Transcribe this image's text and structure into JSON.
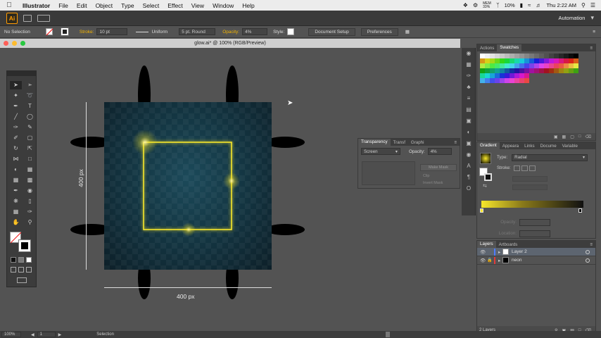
{
  "menubar": {
    "app_name": "Illustrator",
    "items": [
      "File",
      "Edit",
      "Object",
      "Type",
      "Select",
      "Effect",
      "View",
      "Window",
      "Help"
    ],
    "status": {
      "memory": "MEM\n33%",
      "battery": "10%",
      "clock": "Thu 2:22 AM"
    }
  },
  "appbar": {
    "logo": "Ai",
    "workspace": "Automation"
  },
  "control": {
    "selection": "No Selection",
    "stroke_label": "Stroke:",
    "stroke_value": "10 pt",
    "profile": "Uniform",
    "brush": "5 pt. Round",
    "opacity_label": "Opacity:",
    "opacity_value": "4%",
    "style_label": "Style:",
    "doc_setup": "Document Setup",
    "preferences": "Preferences"
  },
  "document": {
    "title": "glow.ai* @ 100% (RGB/Preview)"
  },
  "canvas": {
    "dim_width": "400 px",
    "dim_height": "400 px"
  },
  "transparency_panel": {
    "tabs": [
      "Transparency",
      "Transf",
      "Graphi"
    ],
    "blend_mode": "Screen",
    "opacity_label": "Opacity:",
    "opacity_value": "4%",
    "make_mask": "Make Mask",
    "clip": "Clip",
    "invert_mask": "Invert Mask"
  },
  "swatches_panel": {
    "tabs": [
      "Actions",
      "Swatches"
    ]
  },
  "gradient_panel": {
    "tabs": [
      "Gradient",
      "Appeara",
      "Links",
      "Docume",
      "Variable"
    ],
    "type_label": "Type:",
    "type_value": "Radial",
    "stroke_label": "Stroke:",
    "opacity_label": "Opacity:",
    "location_label": "Location:"
  },
  "layers_panel": {
    "tabs": [
      "Layers",
      "Artboards"
    ],
    "layers": [
      {
        "name": "Layer 2",
        "color": "#4f7cff"
      },
      {
        "name": "neon",
        "color": "#e33b3b"
      }
    ],
    "count": "2 Layers"
  },
  "statusbar": {
    "zoom": "100%",
    "page": "1",
    "tool": "Selection"
  },
  "colors": {
    "neon": "#f7e72b",
    "artboard_center": "#1c4a5a",
    "artboard_edge": "#0d1f28"
  }
}
